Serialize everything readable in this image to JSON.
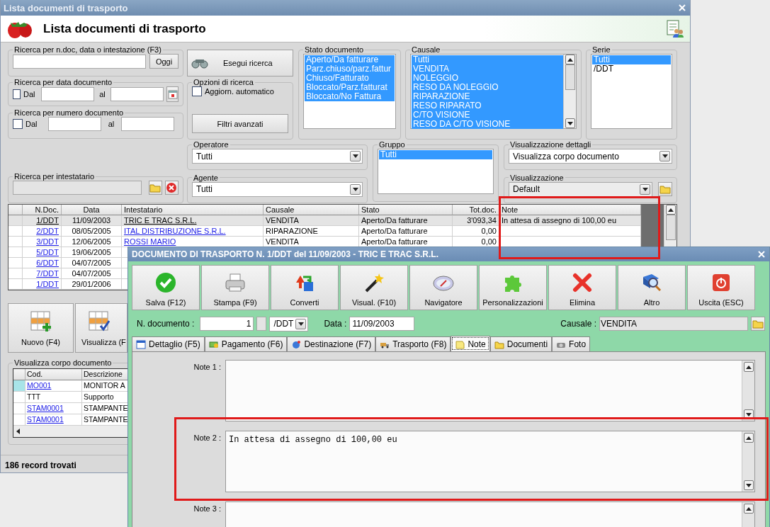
{
  "list_window": {
    "title": "Lista documenti di trasporto",
    "header_title": "Lista documenti di trasporto",
    "text_search": {
      "legend": "Ricerca per n.doc, data o intestazione (F3)",
      "button": "Oggi"
    },
    "date_search": {
      "legend": "Ricerca per data documento",
      "from_label": "Dal",
      "checked": false,
      "to_label": "al"
    },
    "number_search": {
      "legend": "Ricerca per numero documento",
      "from_label": "Dal",
      "checked": false,
      "to_label": "al"
    },
    "holder_search": {
      "legend": "Ricerca per intestatario"
    },
    "search_button": "Esegui ricerca",
    "options": {
      "legend": "Opzioni di ricerca",
      "auto_update": {
        "label": "Aggiorn. automatico",
        "checked": false
      },
      "advanced_button": "Filtri avanzati"
    },
    "status_filter": {
      "legend": "Stato documento",
      "items": [
        {
          "label": "Aperto/Da fatturare",
          "selected": true
        },
        {
          "label": "Parz.chiuso/parz.fattur",
          "selected": true
        },
        {
          "label": "Chiuso/Fatturato",
          "selected": true
        },
        {
          "label": "Bloccato/Parz.fatturat",
          "selected": true
        },
        {
          "label": "Bloccato/No Fattura",
          "selected": true
        }
      ]
    },
    "reason_filter": {
      "legend": "Causale",
      "items": [
        {
          "label": "Tutti",
          "selected": true
        },
        {
          "label": "VENDITA",
          "selected": true
        },
        {
          "label": "NOLEGGIO",
          "selected": true
        },
        {
          "label": "RESO DA NOLEGGIO",
          "selected": true
        },
        {
          "label": "RIPARAZIONE",
          "selected": true
        },
        {
          "label": "RESO RIPARATO",
          "selected": true
        },
        {
          "label": "C/TO VISIONE",
          "selected": true
        },
        {
          "label": "RESO DA C/TO VISIONE",
          "selected": true
        }
      ]
    },
    "series_filter": {
      "legend": "Serie",
      "items": [
        {
          "label": "Tutti",
          "selected": true
        },
        {
          "label": "/DDT",
          "selected": false
        }
      ]
    },
    "operator": {
      "legend": "Operatore",
      "value": "Tutti"
    },
    "agent": {
      "legend": "Agente",
      "value": "Tutti"
    },
    "group_filter": {
      "legend": "Gruppo",
      "items": [
        {
          "label": "Tutti",
          "selected": true
        }
      ]
    },
    "detail_view": {
      "legend": "Visualizzazione dettagli",
      "value": "Visualizza corpo documento"
    },
    "view": {
      "legend": "Visualizzazione",
      "value": "Default"
    },
    "table": {
      "columns": [
        "N.Doc.",
        "Data",
        "Intestatario",
        "Causale",
        "Stato",
        "Tot.doc.",
        "Note"
      ],
      "rows": [
        {
          "selected": true,
          "cells": [
            "1/DDT",
            "11/09/2003",
            "TRIC E TRAC S.R.L.",
            "VENDITA",
            "Aperto/Da fatturare",
            "3'093,34",
            "In attesa di assegno di 100,00 eu"
          ]
        },
        {
          "selected": false,
          "cells": [
            "2/DDT",
            "08/05/2005",
            "ITAL DISTRIBUZIONE S.R.L.",
            "RIPARAZIONE",
            "Aperto/Da fatturare",
            "0,00"
          ]
        },
        {
          "selected": false,
          "cells": [
            "3/DDT",
            "12/06/2005",
            "ROSSI MARIO",
            "VENDITA",
            "Aperto/Da fatturare",
            "0,00"
          ]
        },
        {
          "selected": false,
          "cells": [
            "5/DDT",
            "19/06/2005"
          ]
        },
        {
          "selected": false,
          "cells": [
            "6/DDT",
            "04/07/2005"
          ]
        },
        {
          "selected": false,
          "cells": [
            "7/DDT",
            "04/07/2005"
          ]
        },
        {
          "selected": false,
          "cells": [
            "1/DDT",
            "29/01/2006"
          ]
        }
      ]
    },
    "actions": [
      "Nuovo (F4)",
      "Visualizza (F"
    ],
    "body_grid": {
      "legend": "Visualizza corpo documento",
      "columns": [
        "Cod.",
        "Descrizione"
      ],
      "rows": [
        {
          "selected": true,
          "link": true,
          "cells": [
            "MO001",
            "MONITOR A"
          ]
        },
        {
          "selected": false,
          "link": false,
          "cells": [
            "TTT",
            "Supporto"
          ]
        },
        {
          "selected": false,
          "link": true,
          "cells": [
            "STAM0001",
            "STAMPANTE"
          ]
        },
        {
          "selected": false,
          "link": true,
          "cells": [
            "STAM0001",
            "STAMPANTE"
          ]
        }
      ]
    },
    "status_bar": "186 record trovati"
  },
  "document_window": {
    "title": "DOCUMENTO DI TRASPORTO N. 1/DDT del 11/09/2003 - TRIC E TRAC S.R.L.",
    "toolbar": [
      "Salva (F12)",
      "Stampa (F9)",
      "Converti",
      "Visual. (F10)",
      "Navigatore",
      "Personalizzazioni",
      "Elimina",
      "Altro",
      "Uscita (ESC)"
    ],
    "number_label": "N. documento :",
    "number": "1",
    "series": "/DDT",
    "date_label": "Data :",
    "date": "11/09/2003",
    "reason_label": "Causale :",
    "reason": "VENDITA",
    "tabs": [
      {
        "label": "Dettaglio (F5)",
        "selected": false
      },
      {
        "label": "Pagamento (F6)",
        "selected": false
      },
      {
        "label": "Destinazione (F7)",
        "selected": false
      },
      {
        "label": "Trasporto (F8)",
        "selected": false
      },
      {
        "label": "Note",
        "selected": true
      },
      {
        "label": "Documenti",
        "selected": false
      },
      {
        "label": "Foto",
        "selected": false
      }
    ],
    "notes": [
      {
        "label": "Note 1 :"
      },
      {
        "label": "Note 2 :",
        "value": "In attesa di assegno di 100,00 eu"
      },
      {
        "label": "Note 3 :"
      }
    ]
  }
}
